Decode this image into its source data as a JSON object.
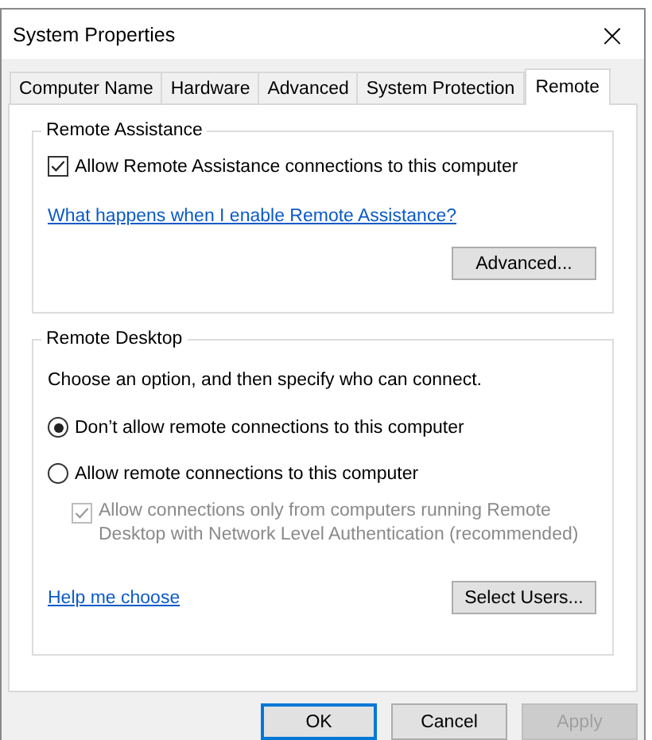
{
  "window": {
    "title": "System Properties",
    "close": "×"
  },
  "tabs": [
    {
      "label": "Computer Name",
      "selected": false
    },
    {
      "label": "Hardware",
      "selected": false
    },
    {
      "label": "Advanced",
      "selected": false
    },
    {
      "label": "System Protection",
      "selected": false
    },
    {
      "label": "Remote",
      "selected": true
    }
  ],
  "remote_assistance": {
    "title": "Remote Assistance",
    "allow": {
      "label": "Allow Remote Assistance connections to this computer",
      "checked": true
    },
    "link": "What happens when I enable Remote Assistance?",
    "button": "Advanced..."
  },
  "remote_desktop": {
    "title": "Remote Desktop",
    "intro": "Choose an option, and then specify who can connect.",
    "options": [
      {
        "label": "Don’t allow remote connections to this computer",
        "selected": true
      },
      {
        "label": "Allow remote connections to this computer",
        "selected": false
      }
    ],
    "nla": {
      "label": "Allow connections only from computers running Remote Desktop with Network Level Authentication (recommended)",
      "checked": true,
      "disabled": true
    },
    "link": "Help me choose",
    "button": "Select Users..."
  },
  "buttons": [
    {
      "label": "OK",
      "default": true,
      "disabled": false
    },
    {
      "label": "Cancel",
      "default": false,
      "disabled": false
    },
    {
      "label": "Apply",
      "default": false,
      "disabled": true
    }
  ]
}
